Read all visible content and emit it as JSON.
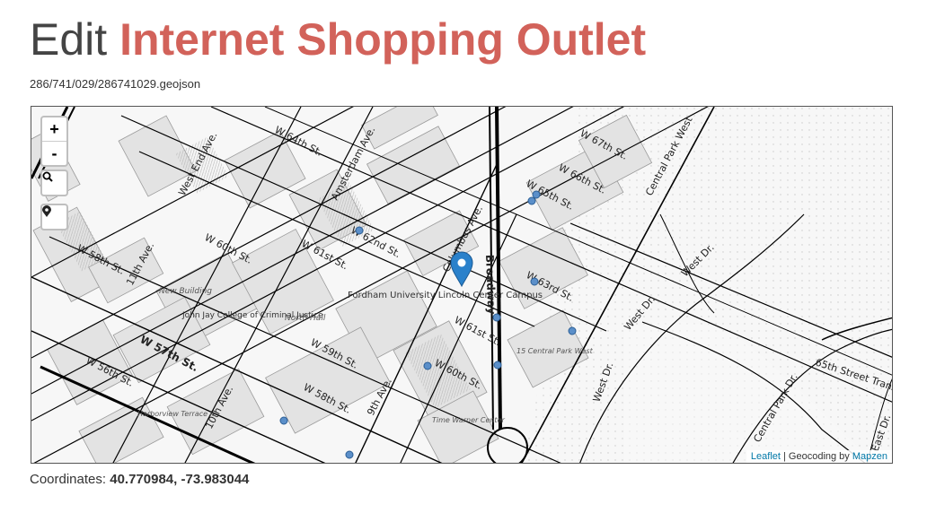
{
  "header": {
    "prefix": "Edit",
    "name": "Internet Shopping Outlet"
  },
  "file_path": "286/741/029/286741029.geojson",
  "map": {
    "zoom_in": "+",
    "zoom_out": "-",
    "search_icon": "search-icon",
    "locate_icon": "location-pin-icon",
    "labels": {
      "w64": "W 64th St.",
      "w67": "W 67th St.",
      "w66": "W 66th St.",
      "w65": "W 65th St.",
      "cpw": "Central Park West",
      "amsterdam": "Amsterdam Ave.",
      "westend": "West End Ave.",
      "w62": "W 62nd St.",
      "w61a": "W 61st St.",
      "w60a": "W 60th St.",
      "w58": "W 58th St.",
      "ave11": "11th Ave.",
      "newbldg": "New Building",
      "jjay": "John Jay College of Criminal Justice",
      "fordham": "Fordham University Lincoln Center Campus",
      "northhall": "North Hall",
      "w57": "W 57th St.",
      "w56": "W 56th St.",
      "w59": "W 59th St.",
      "w58b": "W 58th St.",
      "broadway": "Broadway",
      "columbus": "Columbus Ave.",
      "w63": "W 63rd St.",
      "w61b": "W 61st St.",
      "w60b": "W 60th St.",
      "cpw15": "15 Central Park West",
      "timewarner": "Time Warner Center",
      "harborview": "Harborview Terrace I",
      "ave10": "10th Ave.",
      "ave9": "9th Ave.",
      "westdr1": "West Dr.",
      "westdr2": "West Dr.",
      "westdr3": "West Dr.",
      "centralparkdr": "Central Park Dr.",
      "w65transverse": "65th Street Trans",
      "eastdr": "East Dr."
    },
    "attribution": {
      "leaflet": "Leaflet",
      "separator": " | Geocoding by ",
      "mapzen": "Mapzen"
    },
    "colors": {
      "marker": "#2a81cb",
      "poi": "#5b8fc9",
      "road": "#000000"
    }
  },
  "coordinates": {
    "label": "Coordinates:",
    "value": "40.770984, -73.983044"
  }
}
